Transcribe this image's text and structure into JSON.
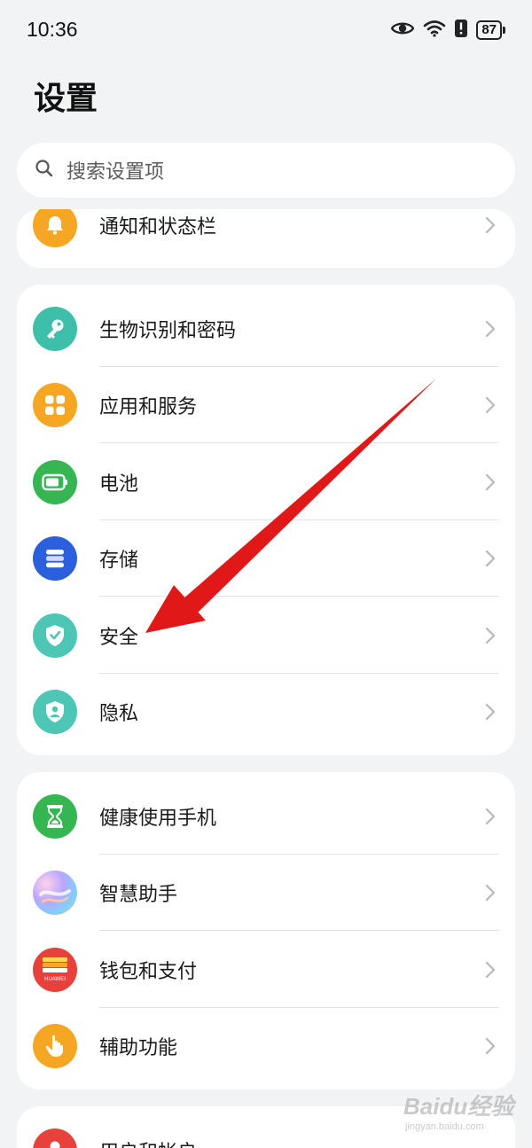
{
  "status_bar": {
    "time": "10:36",
    "battery": "87",
    "icons": [
      "eye-icon",
      "wifi-icon",
      "alert-icon",
      "battery-icon"
    ]
  },
  "header": {
    "title": "设置"
  },
  "search": {
    "placeholder": "搜索设置项"
  },
  "group0": {
    "items": [
      {
        "label": "通知和状态栏",
        "icon": "bell-icon",
        "color": "#f5a623"
      }
    ]
  },
  "group1": {
    "items": [
      {
        "label": "生物识别和密码",
        "icon": "key-icon",
        "color": "#3dbfa9"
      },
      {
        "label": "应用和服务",
        "icon": "apps-grid-icon",
        "color": "#f5a623"
      },
      {
        "label": "电池",
        "icon": "battery-icon",
        "color": "#35b653"
      },
      {
        "label": "存储",
        "icon": "storage-icon",
        "color": "#2b5fde"
      },
      {
        "label": "安全",
        "icon": "shield-check-icon",
        "color": "#4dc6b5"
      },
      {
        "label": "隐私",
        "icon": "privacy-shield-icon",
        "color": "#4dc6b5"
      }
    ]
  },
  "group2": {
    "items": [
      {
        "label": "健康使用手机",
        "icon": "hourglass-icon",
        "color": "#35b653"
      },
      {
        "label": "智慧助手",
        "icon": "assistant-icon",
        "color": "#c58ae8"
      },
      {
        "label": "钱包和支付",
        "icon": "wallet-icon",
        "color": "#e8413c"
      },
      {
        "label": "辅助功能",
        "icon": "hand-icon",
        "color": "#f5a623"
      }
    ]
  },
  "group3": {
    "items": [
      {
        "label": "用户和帐户",
        "icon": "user-icon",
        "color": "#e8413c"
      }
    ]
  },
  "wallet_card_text": "HUAWEI",
  "watermark": {
    "main": "Baidu经验",
    "sub": "jingyan.baidu.com"
  }
}
